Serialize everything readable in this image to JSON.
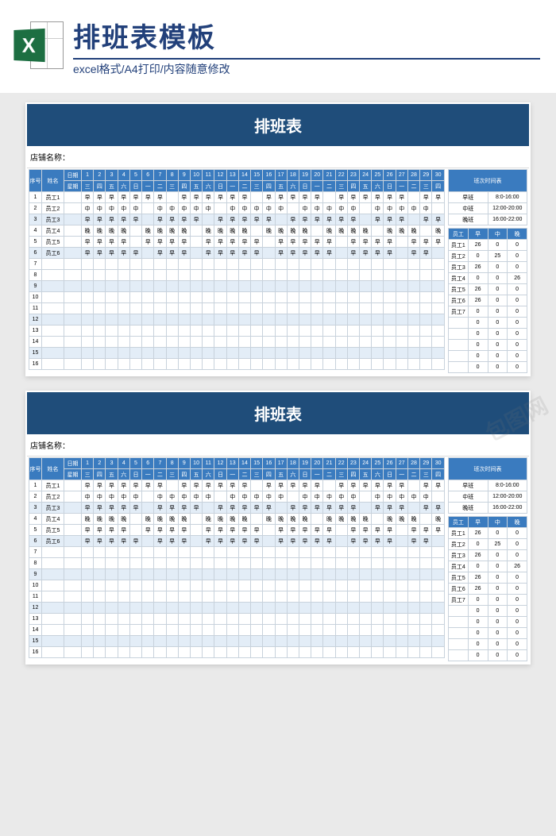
{
  "banner": {
    "title": "排班表模板",
    "subtitle": "excel格式/A4打印/内容随意修改",
    "iconLetter": "X"
  },
  "sheet": {
    "title": "排班表",
    "storeLabel": "店铺名称：",
    "headerCols": {
      "seq": "序号",
      "name": "姓名",
      "dateLabel": "日期",
      "weekLabel": "星期"
    },
    "days": [
      "1",
      "2",
      "3",
      "4",
      "5",
      "6",
      "7",
      "8",
      "9",
      "10",
      "11",
      "12",
      "13",
      "14",
      "15",
      "16",
      "17",
      "18",
      "19",
      "20",
      "21",
      "22",
      "23",
      "24",
      "25",
      "26",
      "27",
      "28",
      "29",
      "30"
    ],
    "weekdays": [
      "三",
      "四",
      "五",
      "六",
      "日",
      "一",
      "二",
      "三",
      "四",
      "五",
      "六",
      "日",
      "一",
      "二",
      "三",
      "四",
      "五",
      "六",
      "日",
      "一",
      "二",
      "三",
      "四",
      "五",
      "六",
      "日",
      "一",
      "二",
      "三",
      "四"
    ],
    "rows": [
      {
        "seq": "1",
        "name": "员工1",
        "cells": [
          "早",
          "早",
          "早",
          "早",
          "早",
          "早",
          "早",
          "",
          "早",
          "早",
          "早",
          "早",
          "早",
          "早",
          "",
          "早",
          "早",
          "早",
          "早",
          "早",
          "",
          "早",
          "早",
          "早",
          "早",
          "早",
          "早",
          "",
          "早",
          "早"
        ]
      },
      {
        "seq": "2",
        "name": "员工2",
        "cells": [
          "中",
          "中",
          "中",
          "中",
          "中",
          "",
          "中",
          "中",
          "中",
          "中",
          "中",
          "",
          "中",
          "中",
          "中",
          "中",
          "中",
          "",
          "中",
          "中",
          "中",
          "中",
          "中",
          "",
          "中",
          "中",
          "中",
          "中",
          "中",
          ""
        ]
      },
      {
        "seq": "3",
        "name": "员工3",
        "cells": [
          "早",
          "早",
          "早",
          "早",
          "早",
          "",
          "早",
          "早",
          "早",
          "早",
          "",
          "早",
          "早",
          "早",
          "早",
          "早",
          "",
          "早",
          "早",
          "早",
          "早",
          "早",
          "早",
          "",
          "早",
          "早",
          "早",
          "",
          "早",
          "早"
        ]
      },
      {
        "seq": "4",
        "name": "员工4",
        "cells": [
          "晚",
          "晚",
          "晚",
          "晚",
          "",
          "晚",
          "晚",
          "晚",
          "晚",
          "",
          "晚",
          "晚",
          "晚",
          "晚",
          "",
          "晚",
          "晚",
          "晚",
          "晚",
          "",
          "晚",
          "晚",
          "晚",
          "晚",
          "",
          "晚",
          "晚",
          "晚",
          "",
          "晚"
        ]
      },
      {
        "seq": "5",
        "name": "员工5",
        "cells": [
          "早",
          "早",
          "早",
          "早",
          "",
          "早",
          "早",
          "早",
          "早",
          "",
          "早",
          "早",
          "早",
          "早",
          "早",
          "",
          "早",
          "早",
          "早",
          "早",
          "早",
          "",
          "早",
          "早",
          "早",
          "早",
          "",
          "早",
          "早",
          "早"
        ]
      },
      {
        "seq": "6",
        "name": "员工6",
        "cells": [
          "早",
          "早",
          "早",
          "早",
          "早",
          "",
          "早",
          "早",
          "早",
          "",
          "早",
          "早",
          "早",
          "早",
          "早",
          "",
          "早",
          "早",
          "早",
          "早",
          "早",
          "",
          "早",
          "早",
          "早",
          "早",
          "",
          "早",
          "早",
          ""
        ]
      },
      {
        "seq": "7",
        "name": "",
        "cells": []
      },
      {
        "seq": "8",
        "name": "",
        "cells": []
      },
      {
        "seq": "9",
        "name": "",
        "cells": []
      },
      {
        "seq": "10",
        "name": "",
        "cells": []
      },
      {
        "seq": "11",
        "name": "",
        "cells": []
      },
      {
        "seq": "12",
        "name": "",
        "cells": []
      },
      {
        "seq": "13",
        "name": "",
        "cells": []
      },
      {
        "seq": "14",
        "name": "",
        "cells": []
      },
      {
        "seq": "15",
        "name": "",
        "cells": []
      },
      {
        "seq": "16",
        "name": "",
        "cells": []
      }
    ],
    "shiftTimes": {
      "title": "班次时间表",
      "rows": [
        {
          "label": "早班",
          "time": "8:0-16:00"
        },
        {
          "label": "中班",
          "time": "12:00-20:00"
        },
        {
          "label": "晚班",
          "time": "16:00-22:00"
        }
      ]
    },
    "summary": {
      "headers": [
        "员工",
        "早",
        "中",
        "晚"
      ],
      "rows": [
        {
          "name": "员工1",
          "e": "26",
          "m": "0",
          "l": "0"
        },
        {
          "name": "员工2",
          "e": "0",
          "m": "25",
          "l": "0"
        },
        {
          "name": "员工3",
          "e": "26",
          "m": "0",
          "l": "0"
        },
        {
          "name": "员工4",
          "e": "0",
          "m": "0",
          "l": "26"
        },
        {
          "name": "员工5",
          "e": "26",
          "m": "0",
          "l": "0"
        },
        {
          "name": "员工6",
          "e": "26",
          "m": "0",
          "l": "0"
        },
        {
          "name": "员工7",
          "e": "0",
          "m": "0",
          "l": "0"
        },
        {
          "name": "",
          "e": "0",
          "m": "0",
          "l": "0"
        },
        {
          "name": "",
          "e": "0",
          "m": "0",
          "l": "0"
        },
        {
          "name": "",
          "e": "0",
          "m": "0",
          "l": "0"
        },
        {
          "name": "",
          "e": "0",
          "m": "0",
          "l": "0"
        },
        {
          "name": "",
          "e": "0",
          "m": "0",
          "l": "0"
        }
      ]
    }
  },
  "watermark": "包图网"
}
